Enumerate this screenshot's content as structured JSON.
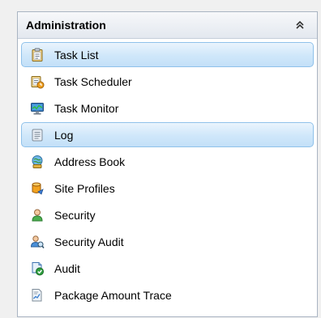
{
  "panel": {
    "title": "Administration",
    "collapse_icon": "double-chevron-up-icon"
  },
  "items": [
    {
      "label": "Task List",
      "icon": "clipboard-icon",
      "highlighted": true
    },
    {
      "label": "Task Scheduler",
      "icon": "scheduler-icon",
      "highlighted": false
    },
    {
      "label": "Task Monitor",
      "icon": "monitor-icon",
      "highlighted": false
    },
    {
      "label": "Log",
      "icon": "log-icon",
      "highlighted": true
    },
    {
      "label": "Address Book",
      "icon": "address-book-icon",
      "highlighted": false
    },
    {
      "label": "Site Profiles",
      "icon": "database-icon",
      "highlighted": false
    },
    {
      "label": "Security",
      "icon": "user-icon",
      "highlighted": false
    },
    {
      "label": "Security Audit",
      "icon": "user-search-icon",
      "highlighted": false
    },
    {
      "label": "Audit",
      "icon": "audit-check-icon",
      "highlighted": false
    },
    {
      "label": "Package Amount Trace",
      "icon": "package-trace-icon",
      "highlighted": false
    }
  ]
}
